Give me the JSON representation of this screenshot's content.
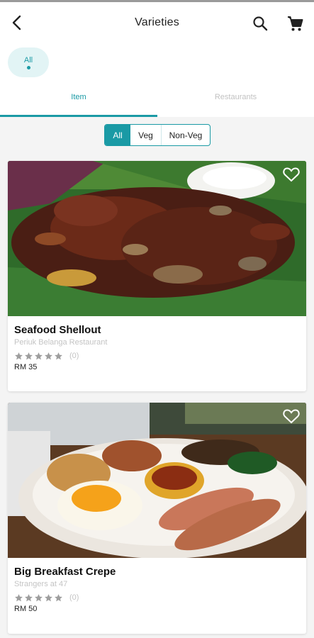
{
  "header": {
    "title": "Varieties",
    "back_icon": "arrow-back-icon",
    "search_icon": "search-icon",
    "cart_icon": "cart-icon"
  },
  "category_chip": {
    "label": "All",
    "selected": true
  },
  "tabs": [
    {
      "label": "Item",
      "active": true
    },
    {
      "label": "Restaurants",
      "active": false
    }
  ],
  "filter": {
    "options": [
      "All",
      "Veg",
      "Non-Veg"
    ],
    "selected": "All"
  },
  "items": [
    {
      "name": "Seafood Shellout",
      "restaurant": "Periuk Belanga Restaurant",
      "rating": 0,
      "rating_count": "(0)",
      "price": "RM 35",
      "favorite": false
    },
    {
      "name": "Big Breakfast Crepe",
      "restaurant": "Strangers at 47",
      "rating": 0,
      "rating_count": "(0)",
      "price": "RM 50",
      "favorite": false
    }
  ],
  "colors": {
    "accent": "#1a9aa5",
    "muted_text": "#c4c4c4",
    "star_empty": "#9e9e9e"
  }
}
